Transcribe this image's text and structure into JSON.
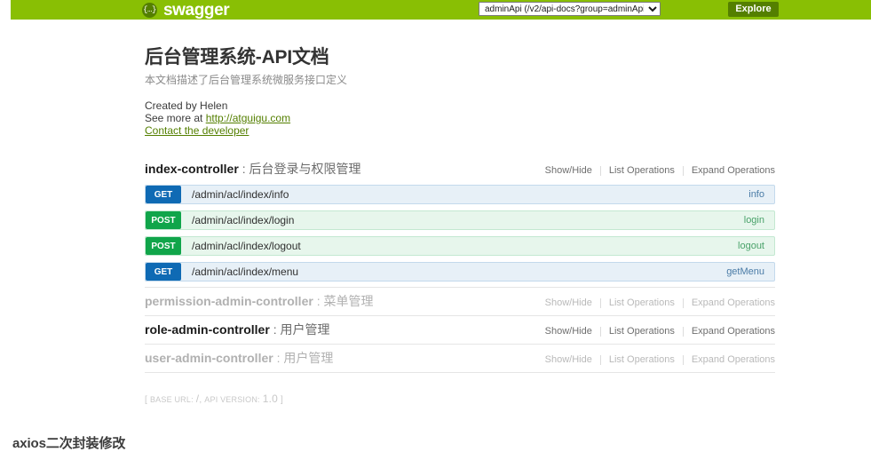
{
  "topbar": {
    "logo_text": "swagger",
    "logo_icon": "swagger-braces-icon",
    "selected_spec": "adminApi (/v2/api-docs?group=adminApi)",
    "spec_options": [
      "adminApi (/v2/api-docs?group=adminApi)"
    ],
    "explore_label": "Explore"
  },
  "info": {
    "title": "后台管理系统-API文档",
    "description": "本文档描述了后台管理系统微服务接口定义",
    "created_by": "Created by Helen",
    "see_more_prefix": "See more at ",
    "see_more_link": "http://atguigu.com",
    "contact_link": "Contact the developer"
  },
  "section_options": {
    "show_hide": "Show/Hide",
    "list_operations": "List Operations",
    "expand_operations": "Expand Operations"
  },
  "resources": [
    {
      "name": "index-controller",
      "separator": ":",
      "description": "后台登录与权限管理",
      "active": true,
      "operations": [
        {
          "method": "GET",
          "path": "/admin/acl/index/info",
          "nickname": "info"
        },
        {
          "method": "POST",
          "path": "/admin/acl/index/login",
          "nickname": "login"
        },
        {
          "method": "POST",
          "path": "/admin/acl/index/logout",
          "nickname": "logout"
        },
        {
          "method": "GET",
          "path": "/admin/acl/index/menu",
          "nickname": "getMenu"
        }
      ]
    },
    {
      "name": "permission-admin-controller",
      "separator": ":",
      "description": "菜单管理",
      "active": false,
      "operations": []
    },
    {
      "name": "role-admin-controller",
      "separator": ":",
      "description": "用户管理",
      "active": true,
      "operations": []
    },
    {
      "name": "user-admin-controller",
      "separator": ":",
      "description": "用户管理",
      "active": false,
      "operations": []
    }
  ],
  "footer": {
    "open_bracket": "[",
    "base_url_label": "BASE URL:",
    "base_url_value": "/",
    "comma": ",",
    "api_version_label": "API VERSION:",
    "api_version_value": "1.0",
    "close_bracket": "]"
  },
  "page_footer": {
    "heading": "axios二次封装修改"
  },
  "colors": {
    "header_green": "#89bf04",
    "button_green": "#547f00",
    "get_blue": "#0f6ab4",
    "post_green": "#10a54a"
  }
}
